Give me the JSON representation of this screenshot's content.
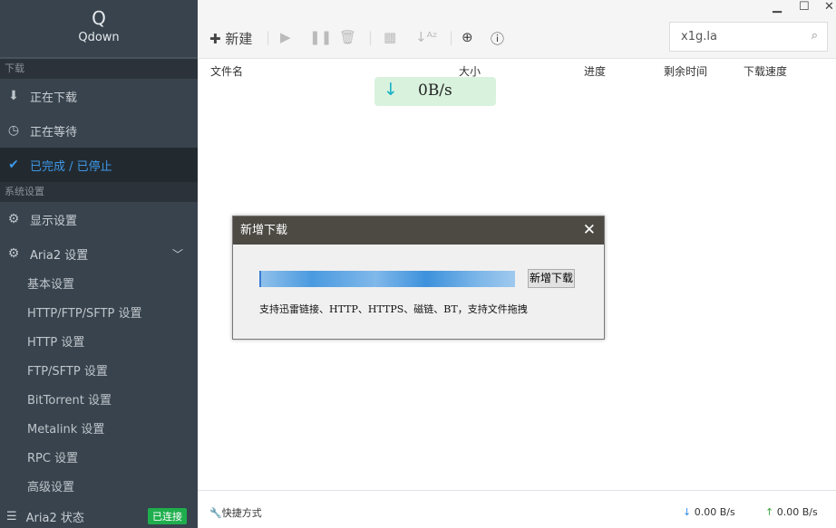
{
  "app": {
    "logo_letter": "Q",
    "name": "Qdown"
  },
  "sidebar": {
    "section_download": "下载",
    "downloading": "正在下载",
    "waiting": "正在等待",
    "completed": "已完成 / 已停止",
    "section_settings": "系统设置",
    "display": "显示设置",
    "aria2": "Aria2 设置",
    "sub": [
      "基本设置",
      "HTTP/FTP/SFTP 设置",
      "HTTP 设置",
      "FTP/SFTP 设置",
      "BitTorrent 设置",
      "Metalink 设置",
      "RPC 设置",
      "高级设置"
    ],
    "status_label": "Aria2 状态",
    "status_badge": "已连接"
  },
  "toolbar": {
    "new_label": "新建",
    "search_value": "x1g.la"
  },
  "table": {
    "columns": [
      "文件名",
      "大小",
      "进度",
      "剩余时间",
      "下载速度"
    ]
  },
  "speed_overlay": "0B/s",
  "footer": {
    "shortcuts": "快捷方式",
    "down": "0.00 B/s",
    "up": "0.00 B/s"
  },
  "dialog": {
    "title": "新增下载",
    "button": "新增下载",
    "hint": "支持迅雷链接、HTTP、HTTPS、磁链、BT，支持文件拖拽"
  },
  "colors": {
    "accent": "#3e97e6",
    "connected": "#1fae4d"
  }
}
